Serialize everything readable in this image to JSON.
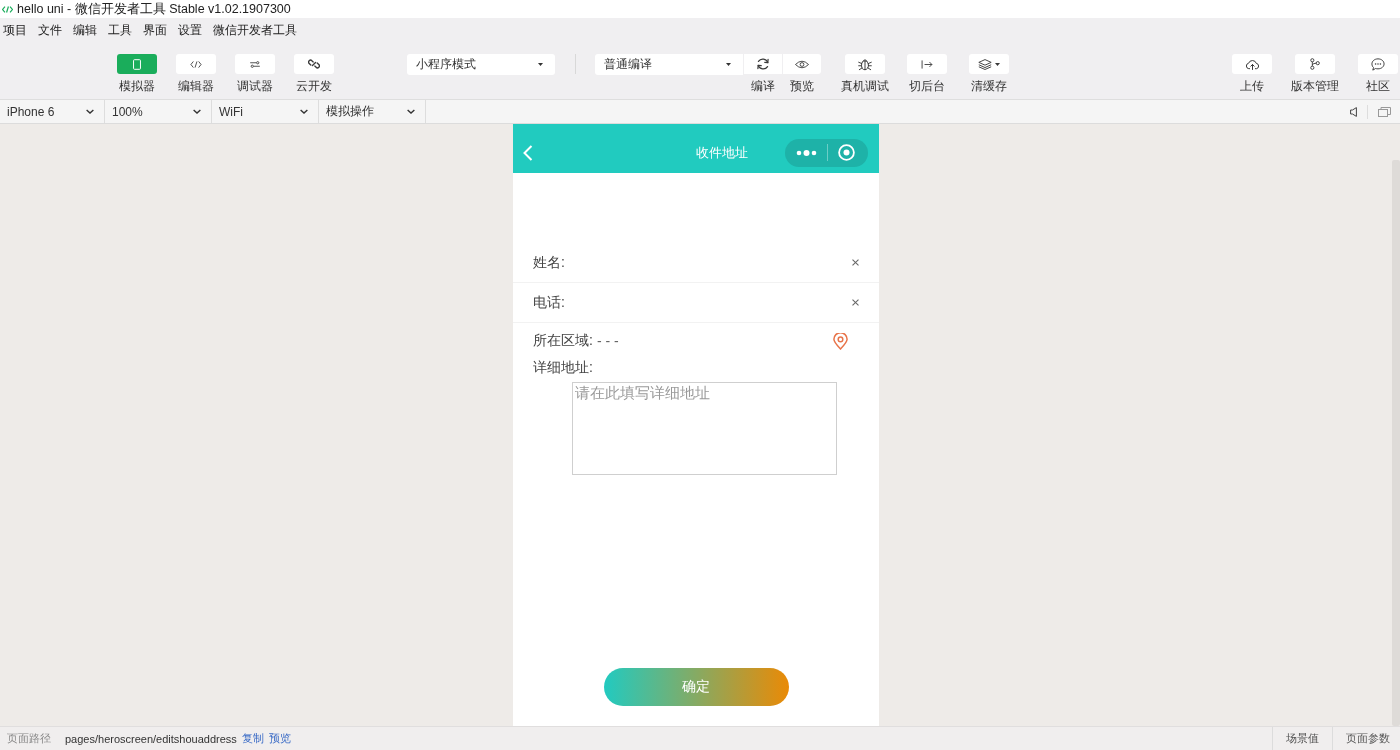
{
  "window": {
    "title": "hello uni - 微信开发者工具 Stable v1.02.1907300"
  },
  "menu": [
    "项目",
    "文件",
    "编辑",
    "工具",
    "界面",
    "设置",
    "微信开发者工具"
  ],
  "toolbar": {
    "views": [
      {
        "label": "模拟器",
        "kind": "phone",
        "on": true
      },
      {
        "label": "编辑器",
        "kind": "code",
        "on": false
      },
      {
        "label": "调试器",
        "kind": "sliders",
        "on": false
      },
      {
        "label": "云开发",
        "kind": "link",
        "on": false
      }
    ],
    "mode_select": {
      "value": "小程序模式"
    },
    "compile_select": {
      "value": "普通编译"
    },
    "compile_actions": [
      {
        "label": "编译",
        "kind": "refresh"
      },
      {
        "label": "预览",
        "kind": "eye"
      }
    ],
    "actions": [
      {
        "label": "真机调试",
        "kind": "bug"
      },
      {
        "label": "切后台",
        "kind": "switch"
      },
      {
        "label": "清缓存",
        "kind": "layers"
      }
    ],
    "right_actions": [
      {
        "label": "上传",
        "kind": "upload"
      },
      {
        "label": "版本管理",
        "kind": "branch"
      },
      {
        "label": "社区",
        "kind": "chat"
      }
    ]
  },
  "device_bar": {
    "selects": [
      {
        "value": "iPhone 6"
      },
      {
        "value": "100%"
      },
      {
        "value": "WiFi"
      },
      {
        "value": "模拟操作"
      }
    ]
  },
  "phone": {
    "nav_title": "收件地址",
    "fields": [
      {
        "kind": "text",
        "label": "姓名:"
      },
      {
        "kind": "text",
        "label": "电话:"
      },
      {
        "kind": "region",
        "label": "所在区域:",
        "region": "- - -"
      },
      {
        "kind": "textarea",
        "label": "详细地址:",
        "placeholder": "请在此填写详细地址"
      }
    ],
    "confirm_button": "确定"
  },
  "status_bar": {
    "path_label": "页面路径",
    "path": "pages/heroscreen/editshouaddress",
    "links": [
      "复制",
      "预览"
    ],
    "right": [
      "场景值",
      "页面参数"
    ]
  }
}
